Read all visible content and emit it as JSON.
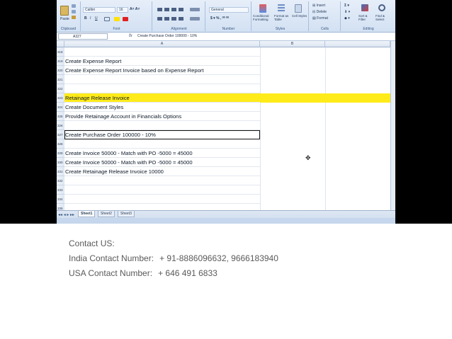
{
  "ribbon": {
    "font_name": "Calibri",
    "font_size": "16",
    "number_format": "General",
    "groups": [
      "Clipboard",
      "Font",
      "Alignment",
      "Number",
      "Styles",
      "Cells",
      "Editing"
    ],
    "paste_label": "Paste",
    "conditional_formatting": "Conditional Formatting",
    "format_as_table": "Format as Table",
    "cell_styles": "Cell Styles",
    "insert": "Insert",
    "delete": "Delete",
    "format": "Format",
    "sort_filter": "Sort & Filter",
    "find_select": "Find & Select"
  },
  "formula_bar": {
    "name_box": "A327",
    "fx": "fx",
    "content": "Create Purchase Order 100000 - 10%"
  },
  "columns": [
    "A",
    "B"
  ],
  "rows": [
    {
      "num": "318",
      "text": "",
      "style": ""
    },
    {
      "num": "319",
      "text": "Create Expense Report",
      "style": ""
    },
    {
      "num": "320",
      "text": "Create Expense Report Invoice based on Expense Report",
      "style": ""
    },
    {
      "num": "321",
      "text": "",
      "style": ""
    },
    {
      "num": "322",
      "text": "",
      "style": ""
    },
    {
      "num": "323",
      "text": "Retainage Release Invoice",
      "style": "yellow"
    },
    {
      "num": "324",
      "text": "Create Document Styles",
      "style": ""
    },
    {
      "num": "325",
      "text": "Provide Retainage Account in Financials Options",
      "style": ""
    },
    {
      "num": "326",
      "text": "",
      "style": ""
    },
    {
      "num": "327",
      "text": "Create Purchase Order 100000 - 10%",
      "style": "selected"
    },
    {
      "num": "328",
      "text": "",
      "style": ""
    },
    {
      "num": "329",
      "text": "Create Invoice 50000 - Match with PO -5000 = 45000",
      "style": ""
    },
    {
      "num": "330",
      "text": "Create Invoice 50000 - Match with PO -5000 = 45000",
      "style": ""
    },
    {
      "num": "331",
      "text": "Create Retainage Release Invoice 10000",
      "style": ""
    },
    {
      "num": "332",
      "text": "",
      "style": ""
    },
    {
      "num": "333",
      "text": "",
      "style": ""
    },
    {
      "num": "334",
      "text": "",
      "style": ""
    },
    {
      "num": "335",
      "text": "",
      "style": ""
    }
  ],
  "sheets": [
    "Sheet1",
    "Sheet2",
    "Sheet3"
  ],
  "contact": {
    "heading": "Contact US:",
    "india_label": "India Contact Number:",
    "india_value": "+ 91-8886096632, 9666183940",
    "usa_label": "USA Contact Number:",
    "usa_value": "+ 646 491 6833"
  },
  "colors": {
    "highlight": "#ffeb1a",
    "ribbon": "#d3e1f3",
    "text": "#5a5a5a"
  }
}
